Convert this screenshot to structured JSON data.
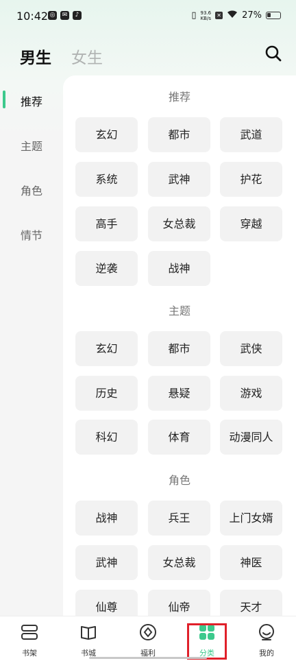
{
  "status_bar": {
    "time": "10:42",
    "net_speed_value": "93.6",
    "net_speed_unit": "KB/s",
    "battery": "27%"
  },
  "header": {
    "tab_active": "男生",
    "tab_inactive": "女生"
  },
  "sidebar": {
    "items": [
      {
        "label": "推荐"
      },
      {
        "label": "主题"
      },
      {
        "label": "角色"
      },
      {
        "label": "情节"
      }
    ]
  },
  "sections": {
    "recommend": {
      "title": "推荐",
      "tags": [
        "玄幻",
        "都市",
        "武道",
        "系统",
        "武神",
        "护花",
        "高手",
        "女总裁",
        "穿越",
        "逆袭",
        "战神"
      ]
    },
    "theme": {
      "title": "主题",
      "tags": [
        "玄幻",
        "都市",
        "武侠",
        "历史",
        "悬疑",
        "游戏",
        "科幻",
        "体育",
        "动漫同人"
      ]
    },
    "role": {
      "title": "角色",
      "tags": [
        "战神",
        "兵王",
        "上门女婿",
        "武神",
        "女总裁",
        "神医",
        "仙尊",
        "仙帝",
        "天才"
      ]
    }
  },
  "bottom_nav": {
    "items": [
      {
        "label": "书架"
      },
      {
        "label": "书城"
      },
      {
        "label": "福利"
      },
      {
        "label": "分类"
      },
      {
        "label": "我的"
      }
    ],
    "active": "分类",
    "highlight_color": "#e0202a"
  },
  "colors": {
    "accent": "#3cc98c",
    "chip_bg": "#f2f2f2"
  }
}
